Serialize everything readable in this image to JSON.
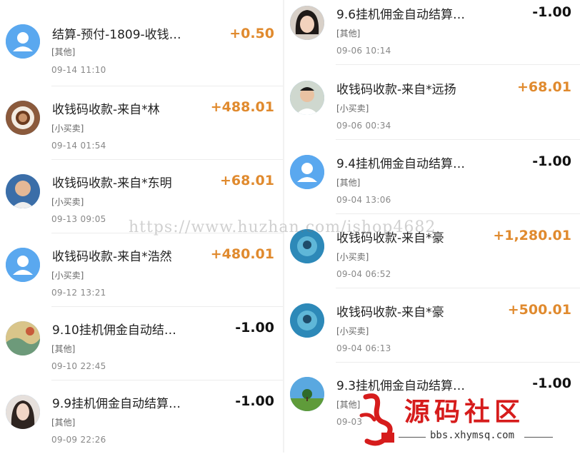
{
  "left_column": {
    "items": [
      {
        "title": "结算-预付-1809-收钱…",
        "category": "[其他]",
        "time": "09-14  11:10",
        "amount": "+0.50",
        "sign": "plus",
        "avatar": "default-user"
      },
      {
        "title": "收钱码收款-来自*林",
        "category": "[小买卖]",
        "time": "09-14  01:54",
        "amount": "+488.01",
        "sign": "plus",
        "avatar": "coffee"
      },
      {
        "title": "收钱码收款-来自*东明",
        "category": "[小买卖]",
        "time": "09-13  09:05",
        "amount": "+68.01",
        "sign": "plus",
        "avatar": "man-portrait"
      },
      {
        "title": "收钱码收款-来自*浩然",
        "category": "[小买卖]",
        "time": "09-12  13:21",
        "amount": "+480.01",
        "sign": "plus",
        "avatar": "default-user"
      },
      {
        "title": "9.10挂机佣金自动结…",
        "category": "[其他]",
        "time": "09-10  22:45",
        "amount": "-1.00",
        "sign": "minus",
        "avatar": "painting"
      },
      {
        "title": "9.9挂机佣金自动结算…",
        "category": "[其他]",
        "time": "09-09  22:26",
        "amount": "-1.00",
        "sign": "minus",
        "avatar": "woman-portrait"
      }
    ]
  },
  "right_column": {
    "items": [
      {
        "title": "9.6挂机佣金自动结算…",
        "category": "[其他]",
        "time": "09-06  10:14",
        "amount": "-1.00",
        "sign": "minus",
        "avatar": "girl-portrait"
      },
      {
        "title": "收钱码收款-来自*远扬",
        "category": "[小买卖]",
        "time": "09-06  00:34",
        "amount": "+68.01",
        "sign": "plus",
        "avatar": "boy-portrait"
      },
      {
        "title": "9.4挂机佣金自动结算…",
        "category": "[其他]",
        "time": "09-04  13:06",
        "amount": "-1.00",
        "sign": "minus",
        "avatar": "default-user"
      },
      {
        "title": "收钱码收款-来自*豪",
        "category": "[小买卖]",
        "time": "09-04  06:52",
        "amount": "+1,280.01",
        "sign": "plus",
        "avatar": "underwater"
      },
      {
        "title": "收钱码收款-来自*豪",
        "category": "[小买卖]",
        "time": "09-04  06:13",
        "amount": "+500.01",
        "sign": "plus",
        "avatar": "underwater"
      },
      {
        "title": "9.3挂机佣金自动结算…",
        "category": "[其他]",
        "time": "09-03",
        "amount": "-1.00",
        "sign": "minus",
        "avatar": "tree-landscape"
      }
    ]
  },
  "watermark": {
    "text": "https://www.huzhan.com/ishop4682"
  },
  "logo": {
    "seal_text": "小猿",
    "name": "源码社区",
    "url": "bbs.xhymsq.com"
  },
  "colors": {
    "positive_amount": "#e08a2e",
    "negative_amount": "#111111",
    "default_avatar": "#5aa8ef",
    "logo_red": "#d61c1c"
  }
}
